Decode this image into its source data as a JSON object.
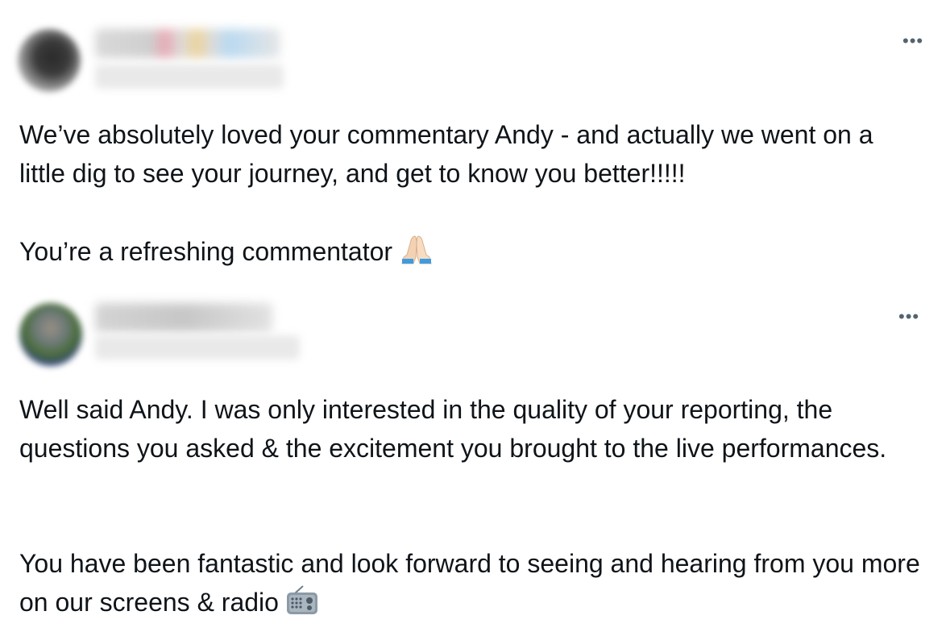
{
  "posts": [
    {
      "more_label": "•••",
      "paragraphs": [
        "We’ve absolutely loved your commentary Andy - and actually we went on a little dig to see your journey, and get to know you better!!!!!",
        "You’re a refreshing commentator"
      ],
      "emoji": "folded-hands-icon"
    },
    {
      "more_label": "•••",
      "paragraphs": [
        "Well said Andy. I was only interested in the quality of your reporting, the questions you asked & the excitement you brought to the live performances.",
        "You have been fantastic and look forward to seeing and hearing from you more on our screens & radio"
      ],
      "emoji": "radio-icon"
    }
  ]
}
